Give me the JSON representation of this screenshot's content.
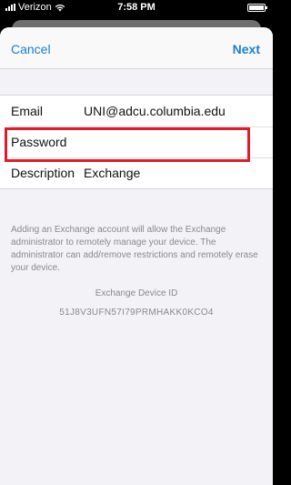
{
  "status_bar": {
    "carrier": "Verizon",
    "time": "7:58 PM"
  },
  "nav": {
    "cancel_label": "Cancel",
    "next_label": "Next"
  },
  "form": {
    "email_label": "Email",
    "email_value": "UNI@adcu.columbia.edu",
    "password_label": "Password",
    "password_value": "",
    "description_label": "Description",
    "description_value": "Exchange"
  },
  "info": {
    "text": "Adding an Exchange account will allow the Exchange administrator to remotely manage your device. The administrator can add/remove restrictions and remotely erase your device.",
    "device_id_title": "Exchange Device ID",
    "device_id_value": "51J8V3UFN57I79PRMHAKK0KCO4"
  },
  "colors": {
    "accent": "#1a7fd4",
    "highlight": "#e21b2c",
    "background": "#f2f2f7"
  }
}
